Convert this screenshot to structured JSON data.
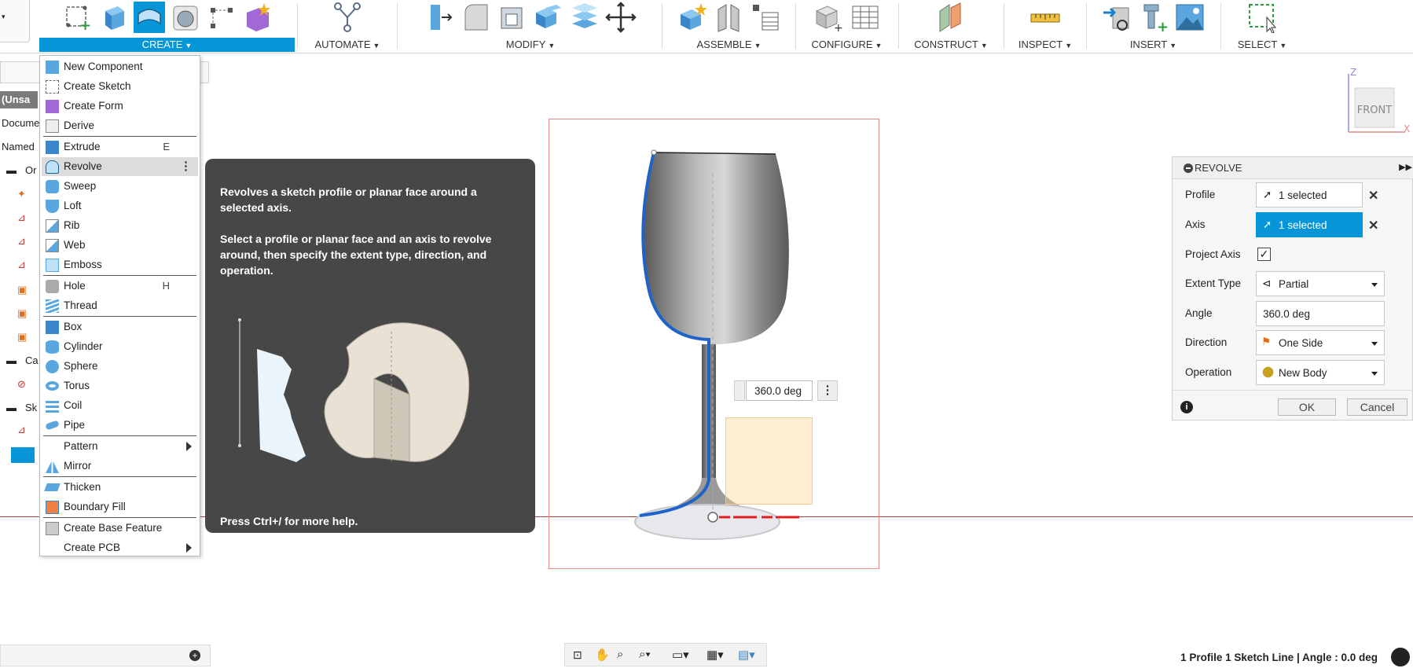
{
  "toolbar": {
    "groups": [
      {
        "label": "CREATE"
      },
      {
        "label": "AUTOMATE"
      },
      {
        "label": "MODIFY"
      },
      {
        "label": "ASSEMBLE"
      },
      {
        "label": "CONFIGURE"
      },
      {
        "label": "CONSTRUCT"
      },
      {
        "label": "INSPECT"
      },
      {
        "label": "INSERT"
      },
      {
        "label": "SELECT"
      }
    ],
    "accent": "#0696d7"
  },
  "browser": {
    "items": [
      "(Unsa",
      "Docume",
      "Named",
      "Or",
      "Ca",
      "Sk"
    ]
  },
  "create_menu": {
    "items": [
      {
        "label": "New Component"
      },
      {
        "label": "Create Sketch"
      },
      {
        "label": "Create Form"
      },
      {
        "label": "Derive"
      },
      {
        "label": "Extrude",
        "shortcut": "E"
      },
      {
        "label": "Revolve"
      },
      {
        "label": "Sweep"
      },
      {
        "label": "Loft"
      },
      {
        "label": "Rib"
      },
      {
        "label": "Web"
      },
      {
        "label": "Emboss"
      },
      {
        "label": "Hole",
        "shortcut": "H"
      },
      {
        "label": "Thread"
      },
      {
        "label": "Box"
      },
      {
        "label": "Cylinder"
      },
      {
        "label": "Sphere"
      },
      {
        "label": "Torus"
      },
      {
        "label": "Coil"
      },
      {
        "label": "Pipe"
      },
      {
        "label": "Pattern"
      },
      {
        "label": "Mirror"
      },
      {
        "label": "Thicken"
      },
      {
        "label": "Boundary Fill"
      },
      {
        "label": "Create Base Feature"
      },
      {
        "label": "Create PCB"
      }
    ]
  },
  "tooltip": {
    "line1": "Revolves a sketch profile or planar face around a selected axis.",
    "line2": "Select a profile or planar face and an axis to revolve around, then specify the extent type, direction, and operation.",
    "footer": "Press Ctrl+/ for more help."
  },
  "viewcube": {
    "label": "FRONT",
    "z": "Z",
    "x": "X"
  },
  "viewport": {
    "angle_value": "360.0 deg"
  },
  "revolve_dialog": {
    "title": "REVOLVE",
    "profile_label": "Profile",
    "profile_value": "1 selected",
    "axis_label": "Axis",
    "axis_value": "1 selected",
    "project_axis_label": "Project Axis",
    "extent_type_label": "Extent Type",
    "extent_type_value": "Partial",
    "angle_label": "Angle",
    "angle_value": "360.0 deg",
    "direction_label": "Direction",
    "direction_value": "One Side",
    "operation_label": "Operation",
    "operation_value": "New Body",
    "ok_label": "OK",
    "cancel_label": "Cancel"
  },
  "status": {
    "text": "1 Profile 1 Sketch Line | Angle : 0.0 deg"
  }
}
